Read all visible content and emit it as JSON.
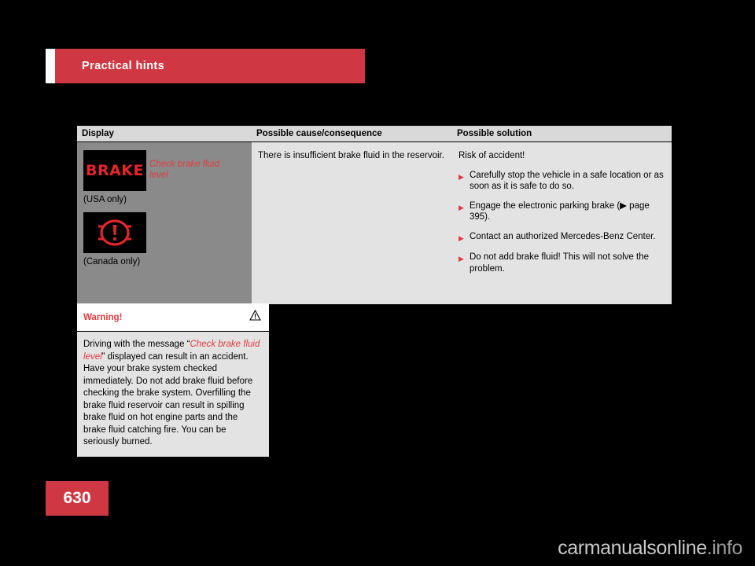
{
  "header": {
    "title": "Practical hints"
  },
  "table": {
    "headers": {
      "display": "Display",
      "cause": "Possible cause/consequence",
      "solution": "Possible solution"
    },
    "row": {
      "display": {
        "message": "Check brake fluid level",
        "icon1_text": "BRAKE",
        "icon1_caption": "(USA only)",
        "icon2_caption": "(Canada only)"
      },
      "cause": "There is insufficient brake fluid in the reservoir.",
      "solution_heading": "Risk of accident!",
      "solution_items": [
        "Carefully stop the vehicle in a safe location or as soon as it is safe to do so.",
        "Engage the electronic parking brake (▶ page 395).",
        "Contact an authorized Mercedes-Benz Center.",
        "Do not add brake fluid! This will not solve the problem."
      ]
    }
  },
  "warning_box": {
    "title": "Warning!",
    "icon": "warning-triangle-icon",
    "text_part1": "Driving with the message “",
    "text_emphasis": "Check brake fluid level",
    "text_part2": "” displayed can result in an accident. Have your brake system checked immediately. Do not add brake fluid before checking the brake system. Overfilling the brake fluid reservoir can result in spilling brake fluid on hot engine parts and the brake fluid catching fire. You can be seriously burned."
  },
  "page_number": "630",
  "watermark": {
    "main": "carmanualsonline",
    "suffix": ".info"
  },
  "colors": {
    "accent_red": "#cf3842",
    "text_red": "#e23b3f",
    "header_gray": "#d9d9d9",
    "cell_gray": "#e3e3e3",
    "display_gray": "#8a8a8a"
  }
}
